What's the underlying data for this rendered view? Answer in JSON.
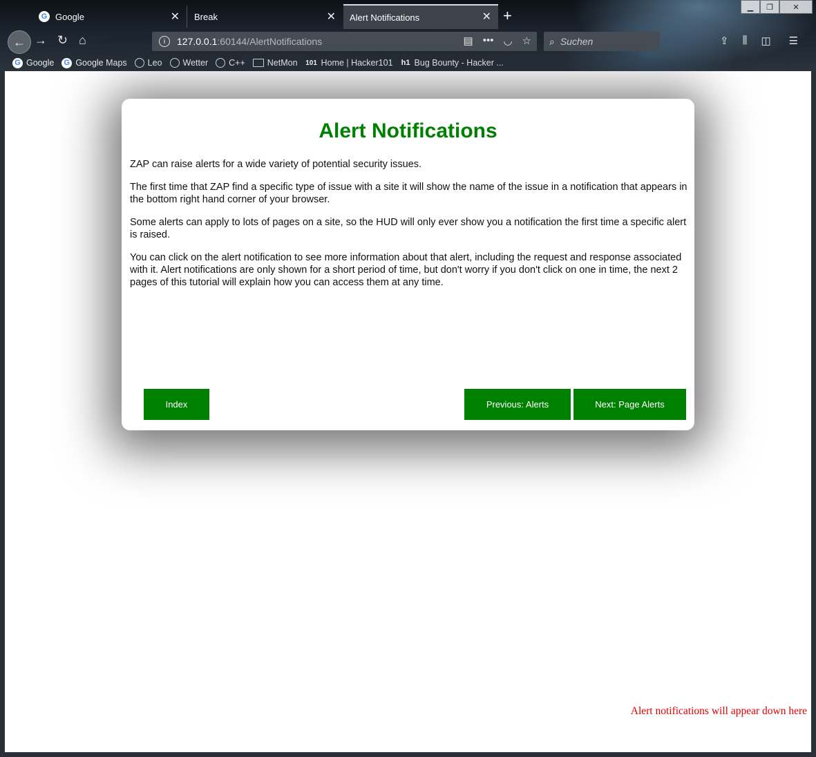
{
  "tabs": [
    {
      "title": "Google",
      "favicon": "google-g-icon",
      "active": false
    },
    {
      "title": "Break",
      "favicon": "",
      "active": false
    },
    {
      "title": "Alert Notifications",
      "favicon": "",
      "active": true
    }
  ],
  "url": {
    "host": "127.0.0.1",
    "rest": ":60144/AlertNotifications"
  },
  "search": {
    "placeholder": "Suchen"
  },
  "bookmarks": [
    {
      "label": "Google",
      "icon": "google-g-icon"
    },
    {
      "label": "Google Maps",
      "icon": "google-g-icon"
    },
    {
      "label": "Leo",
      "icon": "globe-icon"
    },
    {
      "label": "Wetter",
      "icon": "globe-icon"
    },
    {
      "label": "C++",
      "icon": "globe-icon"
    },
    {
      "label": "NetMon",
      "icon": "folder-icon"
    },
    {
      "label": "Home | Hacker101",
      "icon": "hacker101-icon",
      "icon_text": "101"
    },
    {
      "label": "Bug Bounty - Hacker ...",
      "icon": "hackerone-icon",
      "icon_text": "h1"
    }
  ],
  "page": {
    "title": "Alert Notifications",
    "paragraphs": [
      "ZAP can raise alerts for a wide variety of potential security issues.",
      "The first time that ZAP find a specific type of issue with a site it will show the name of the issue in a notification that appears in the bottom right hand corner of your browser.",
      "Some alerts can apply to lots of pages on a site, so the HUD will only ever show you a notification the first time a specific alert is raised.",
      "You can click on the alert notification to see more information about that alert, including the request and response associated with it. Alert notifications are only shown for a short period of time, but don't worry if you don't click on one in time, the next 2 pages of this tutorial will explain how you can access them at any time."
    ],
    "buttons": {
      "index": "Index",
      "previous": "Previous: Alerts",
      "next": "Next: Page Alerts"
    },
    "alert_note": "Alert notifications will appear down here"
  },
  "colors": {
    "accent_green": "#008000",
    "alert_red": "#e00000"
  }
}
